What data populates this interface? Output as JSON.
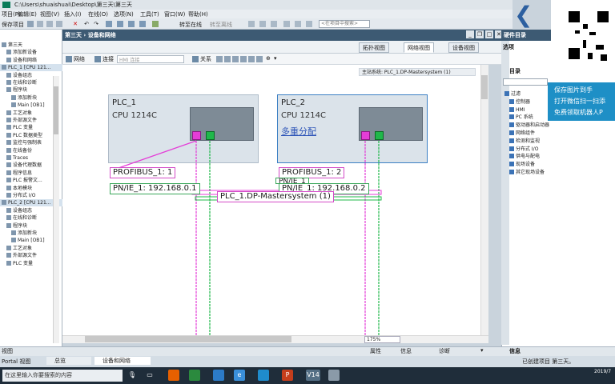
{
  "window": {
    "title": "C:\\Users\\shuaishuai\\Desktop\\第三天\\第三天",
    "menu": [
      "项目(P)",
      "编辑(E)",
      "视图(V)",
      "插入(I)",
      "在线(O)",
      "选项(N)",
      "工具(T)",
      "窗口(W)",
      "帮助(H)"
    ]
  },
  "toolbar": {
    "save_project": "保存项目",
    "go_online": "转至在线",
    "go_offline": "转至离线",
    "search_placeholder": "<在项目中搜索>"
  },
  "project_tree": {
    "items": [
      {
        "label": "第三天",
        "indent": 0
      },
      {
        "label": "添加新设备",
        "indent": 1
      },
      {
        "label": "设备和网络",
        "indent": 1
      },
      {
        "label": "PLC_1 [CPU 121...",
        "indent": 0,
        "selected": true
      },
      {
        "label": "设备组态",
        "indent": 1
      },
      {
        "label": "在线和诊断",
        "indent": 1
      },
      {
        "label": "程序块",
        "indent": 1
      },
      {
        "label": "添加新块",
        "indent": 2
      },
      {
        "label": "Main [OB1]",
        "indent": 2
      },
      {
        "label": "工艺对象",
        "indent": 1
      },
      {
        "label": "外部源文件",
        "indent": 1
      },
      {
        "label": "PLC 变量",
        "indent": 1
      },
      {
        "label": "PLC 数据类型",
        "indent": 1
      },
      {
        "label": "监控与强制表",
        "indent": 1
      },
      {
        "label": "在线备份",
        "indent": 1
      },
      {
        "label": "Traces",
        "indent": 1
      },
      {
        "label": "设备代理数据",
        "indent": 1
      },
      {
        "label": "程序信息",
        "indent": 1
      },
      {
        "label": "PLC 报警文...",
        "indent": 1
      },
      {
        "label": "本地模块",
        "indent": 1
      },
      {
        "label": "分布式 I/O",
        "indent": 1
      },
      {
        "label": "PLC_2 [CPU 121...",
        "indent": 0,
        "selected": true
      },
      {
        "label": "设备组态",
        "indent": 1
      },
      {
        "label": "在线和诊断",
        "indent": 1
      },
      {
        "label": "程序块",
        "indent": 1
      },
      {
        "label": "添加新块",
        "indent": 2
      },
      {
        "label": "Main [OB1]",
        "indent": 2
      },
      {
        "label": "工艺对象",
        "indent": 1
      },
      {
        "label": "外部源文件",
        "indent": 1
      },
      {
        "label": "PLC 变量",
        "indent": 1
      }
    ],
    "footer": "视图"
  },
  "editor": {
    "breadcrumb": "第三天 › 设备和网络",
    "views": [
      "拓扑视图",
      "网络视图",
      "设备视图"
    ],
    "active_view": "网络视图",
    "net_tools": {
      "network": "网络",
      "connections": "连接",
      "connection_type": "HMI 连接",
      "relations": "关系"
    },
    "master_system": "主站系统: PLC_1.DP-Mastersystem (1)",
    "zoom": "175%"
  },
  "devices": [
    {
      "name": "PLC_1",
      "cpu": "CPU 1214C",
      "link": ""
    },
    {
      "name": "PLC_2",
      "cpu": "CPU 1214C",
      "link": "多重分配"
    }
  ],
  "network_labels": {
    "profibus_1": "PROFIBUS_1: 1",
    "profibus_2": "PROFIBUS_1: 2",
    "pnie_1": "PN/IE_1: 192.168.0.1",
    "pnie_2": "PN/IE_1: 192.168.0.2",
    "pnie_hidden": "PN/IE_1",
    "dp_master": "PLC_1.DP-Mastersystem (1)"
  },
  "right_panel": {
    "title": "硬件目录",
    "options": "选项",
    "catalog_head": "目录",
    "catalog": [
      "过滤",
      "控制器",
      "HMI",
      "PC 系统",
      "驱动器和启动器",
      "网络组件",
      "检测和监视",
      "分布式 I/O",
      "供电与配电",
      "现场设备",
      "其它现场设备"
    ]
  },
  "overlay": {
    "promo_lines": [
      "保存图片到手",
      "打开微信扫一扫添",
      "免费领取机器人P"
    ]
  },
  "bottom": {
    "tabs": [
      "属性",
      "信息",
      "诊断"
    ],
    "info": "信息",
    "portal": "Portal 视图",
    "overview": "总览",
    "devnet": "设备和网络",
    "status": "已创建项目 第三天。"
  },
  "taskbar": {
    "search": "在这里输入你要搜索的内容",
    "apps": [
      "Firefox",
      "Files",
      "Edge",
      "PowerPoint",
      "TIA V14"
    ],
    "time": "2019/7"
  },
  "colors": {
    "profibus": "#e43dd7",
    "profinet": "#1fb84a",
    "header": "#3d5a73"
  }
}
